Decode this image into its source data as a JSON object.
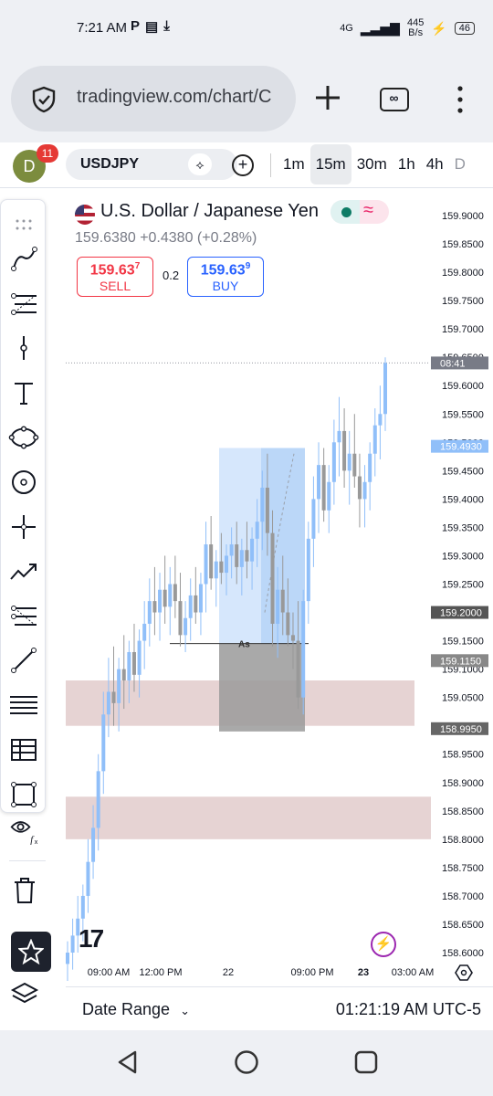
{
  "status": {
    "time": "7:21 AM",
    "network": "4G",
    "speed_value": "445",
    "speed_unit": "B/s",
    "battery": "46"
  },
  "browser": {
    "url": "tradingview.com/chart/C"
  },
  "header": {
    "avatar_letter": "D",
    "notification_count": "11",
    "symbol": "USDJPY",
    "intervals": [
      "1m",
      "15m",
      "30m",
      "1h",
      "4h",
      "D"
    ],
    "active_interval": "15m"
  },
  "legend": {
    "title": "U.S. Dollar / Japanese Yen",
    "price": "159.6380",
    "change": "+0.4380",
    "change_pct": "(+0.28%)",
    "sell_price": "159.63",
    "sell_sup": "7",
    "sell_label": "SELL",
    "buy_price": "159.63",
    "buy_sup": "9",
    "buy_label": "BUY",
    "spread": "0.2"
  },
  "chart_data": {
    "type": "candlestick",
    "y_ticks": [
      "159.9000",
      "159.8500",
      "159.8000",
      "159.7500",
      "159.7000",
      "159.6500",
      "159.6000",
      "159.5500",
      "159.5000",
      "159.4500",
      "159.4000",
      "159.3500",
      "159.3000",
      "159.2500",
      "159.2000",
      "159.1500",
      "159.1000",
      "159.0500",
      "159.0000",
      "158.9500",
      "158.9000",
      "158.8500",
      "158.8000",
      "158.7500",
      "158.7000",
      "158.6500",
      "158.6000"
    ],
    "ylim": [
      158.59,
      159.92
    ],
    "x_ticks": [
      "09:00 AM",
      "12:00 PM",
      "22",
      "09:00 PM",
      "23",
      "03:00 AM"
    ],
    "price_labels": [
      {
        "text": "08:41",
        "value": 159.64,
        "color": "#787b86"
      },
      {
        "text": "159.4930",
        "value": 159.493,
        "color": "#90bff9"
      },
      {
        "text": "159.2000",
        "value": 159.2,
        "color": "#555555"
      },
      {
        "text": "159.1150",
        "value": 159.115,
        "color": "#888888"
      },
      {
        "text": "158.9950",
        "value": 158.995,
        "color": "#666666"
      }
    ],
    "candles": [
      [
        158.58,
        158.62,
        158.55,
        158.6
      ],
      [
        158.6,
        158.66,
        158.57,
        158.63
      ],
      [
        158.63,
        158.7,
        158.6,
        158.66
      ],
      [
        158.66,
        158.72,
        158.62,
        158.7
      ],
      [
        158.7,
        158.8,
        158.67,
        158.76
      ],
      [
        158.76,
        158.86,
        158.73,
        158.82
      ],
      [
        158.82,
        158.95,
        158.78,
        158.92
      ],
      [
        158.92,
        159.06,
        158.88,
        159.02
      ],
      [
        159.02,
        159.12,
        158.98,
        159.06
      ],
      [
        159.06,
        159.14,
        159.0,
        159.04
      ],
      [
        159.04,
        159.12,
        158.99,
        159.1
      ],
      [
        159.1,
        159.16,
        159.03,
        159.08
      ],
      [
        159.08,
        159.15,
        159.04,
        159.13
      ],
      [
        159.13,
        159.18,
        159.06,
        159.09
      ],
      [
        159.09,
        159.17,
        159.05,
        159.15
      ],
      [
        159.15,
        159.22,
        159.1,
        159.18
      ],
      [
        159.18,
        159.26,
        159.14,
        159.22
      ],
      [
        159.22,
        159.28,
        159.16,
        159.2
      ],
      [
        159.2,
        159.27,
        159.15,
        159.24
      ],
      [
        159.24,
        159.3,
        159.18,
        159.21
      ],
      [
        159.21,
        159.28,
        159.16,
        159.25
      ],
      [
        159.25,
        159.3,
        159.19,
        159.22
      ],
      [
        159.22,
        159.27,
        159.14,
        159.16
      ],
      [
        159.16,
        159.22,
        159.13,
        159.19
      ],
      [
        159.19,
        159.26,
        159.15,
        159.23
      ],
      [
        159.23,
        159.28,
        159.18,
        159.2
      ],
      [
        159.2,
        159.27,
        159.16,
        159.25
      ],
      [
        159.25,
        159.36,
        159.2,
        159.32
      ],
      [
        159.32,
        159.37,
        159.24,
        159.26
      ],
      [
        159.26,
        159.31,
        159.21,
        159.29
      ],
      [
        159.29,
        159.34,
        159.25,
        159.27
      ],
      [
        159.27,
        159.32,
        159.23,
        159.3
      ],
      [
        159.3,
        159.35,
        159.26,
        159.32
      ],
      [
        159.32,
        159.36,
        159.25,
        159.28
      ],
      [
        159.28,
        159.33,
        159.23,
        159.31
      ],
      [
        159.31,
        159.36,
        159.26,
        159.29
      ],
      [
        159.29,
        159.35,
        159.24,
        159.33
      ],
      [
        159.33,
        159.4,
        159.28,
        159.36
      ],
      [
        159.36,
        159.45,
        159.31,
        159.42
      ],
      [
        159.42,
        159.48,
        159.3,
        159.34
      ],
      [
        159.34,
        159.38,
        159.14,
        159.18
      ],
      [
        159.18,
        159.28,
        159.12,
        159.24
      ],
      [
        159.24,
        159.3,
        159.16,
        159.2
      ],
      [
        159.2,
        159.26,
        159.14,
        159.16
      ],
      [
        159.16,
        159.2,
        159.1,
        159.15
      ],
      [
        159.15,
        159.22,
        159.03,
        159.05
      ],
      [
        159.05,
        159.24,
        159.02,
        159.22
      ],
      [
        159.22,
        159.36,
        159.18,
        159.33
      ],
      [
        159.33,
        159.44,
        159.28,
        159.4
      ],
      [
        159.4,
        159.5,
        159.34,
        159.46
      ],
      [
        159.46,
        159.49,
        159.36,
        159.38
      ],
      [
        159.38,
        159.46,
        159.34,
        159.43
      ],
      [
        159.43,
        159.54,
        159.39,
        159.5
      ],
      [
        159.5,
        159.58,
        159.44,
        159.52
      ],
      [
        159.52,
        159.56,
        159.42,
        159.45
      ],
      [
        159.45,
        159.52,
        159.39,
        159.48
      ],
      [
        159.48,
        159.55,
        159.42,
        159.44
      ],
      [
        159.44,
        159.48,
        159.35,
        159.4
      ],
      [
        159.4,
        159.46,
        159.35,
        159.43
      ],
      [
        159.43,
        159.5,
        159.38,
        159.48
      ],
      [
        159.48,
        159.56,
        159.44,
        159.53
      ],
      [
        159.53,
        159.6,
        159.47,
        159.55
      ],
      [
        159.55,
        159.65,
        159.52,
        159.64
      ]
    ],
    "zones": [
      {
        "from": 159.0,
        "to": 159.08,
        "color": "#dcc0c0"
      },
      {
        "from": 158.8,
        "to": 158.875,
        "color": "#dcc0c0"
      }
    ],
    "position": {
      "label": "As",
      "entry": 159.145,
      "target": 159.49,
      "stop": 158.99
    }
  },
  "bottom": {
    "date_range": "Date Range",
    "clock": "01:21:19 AM UTC-5"
  }
}
